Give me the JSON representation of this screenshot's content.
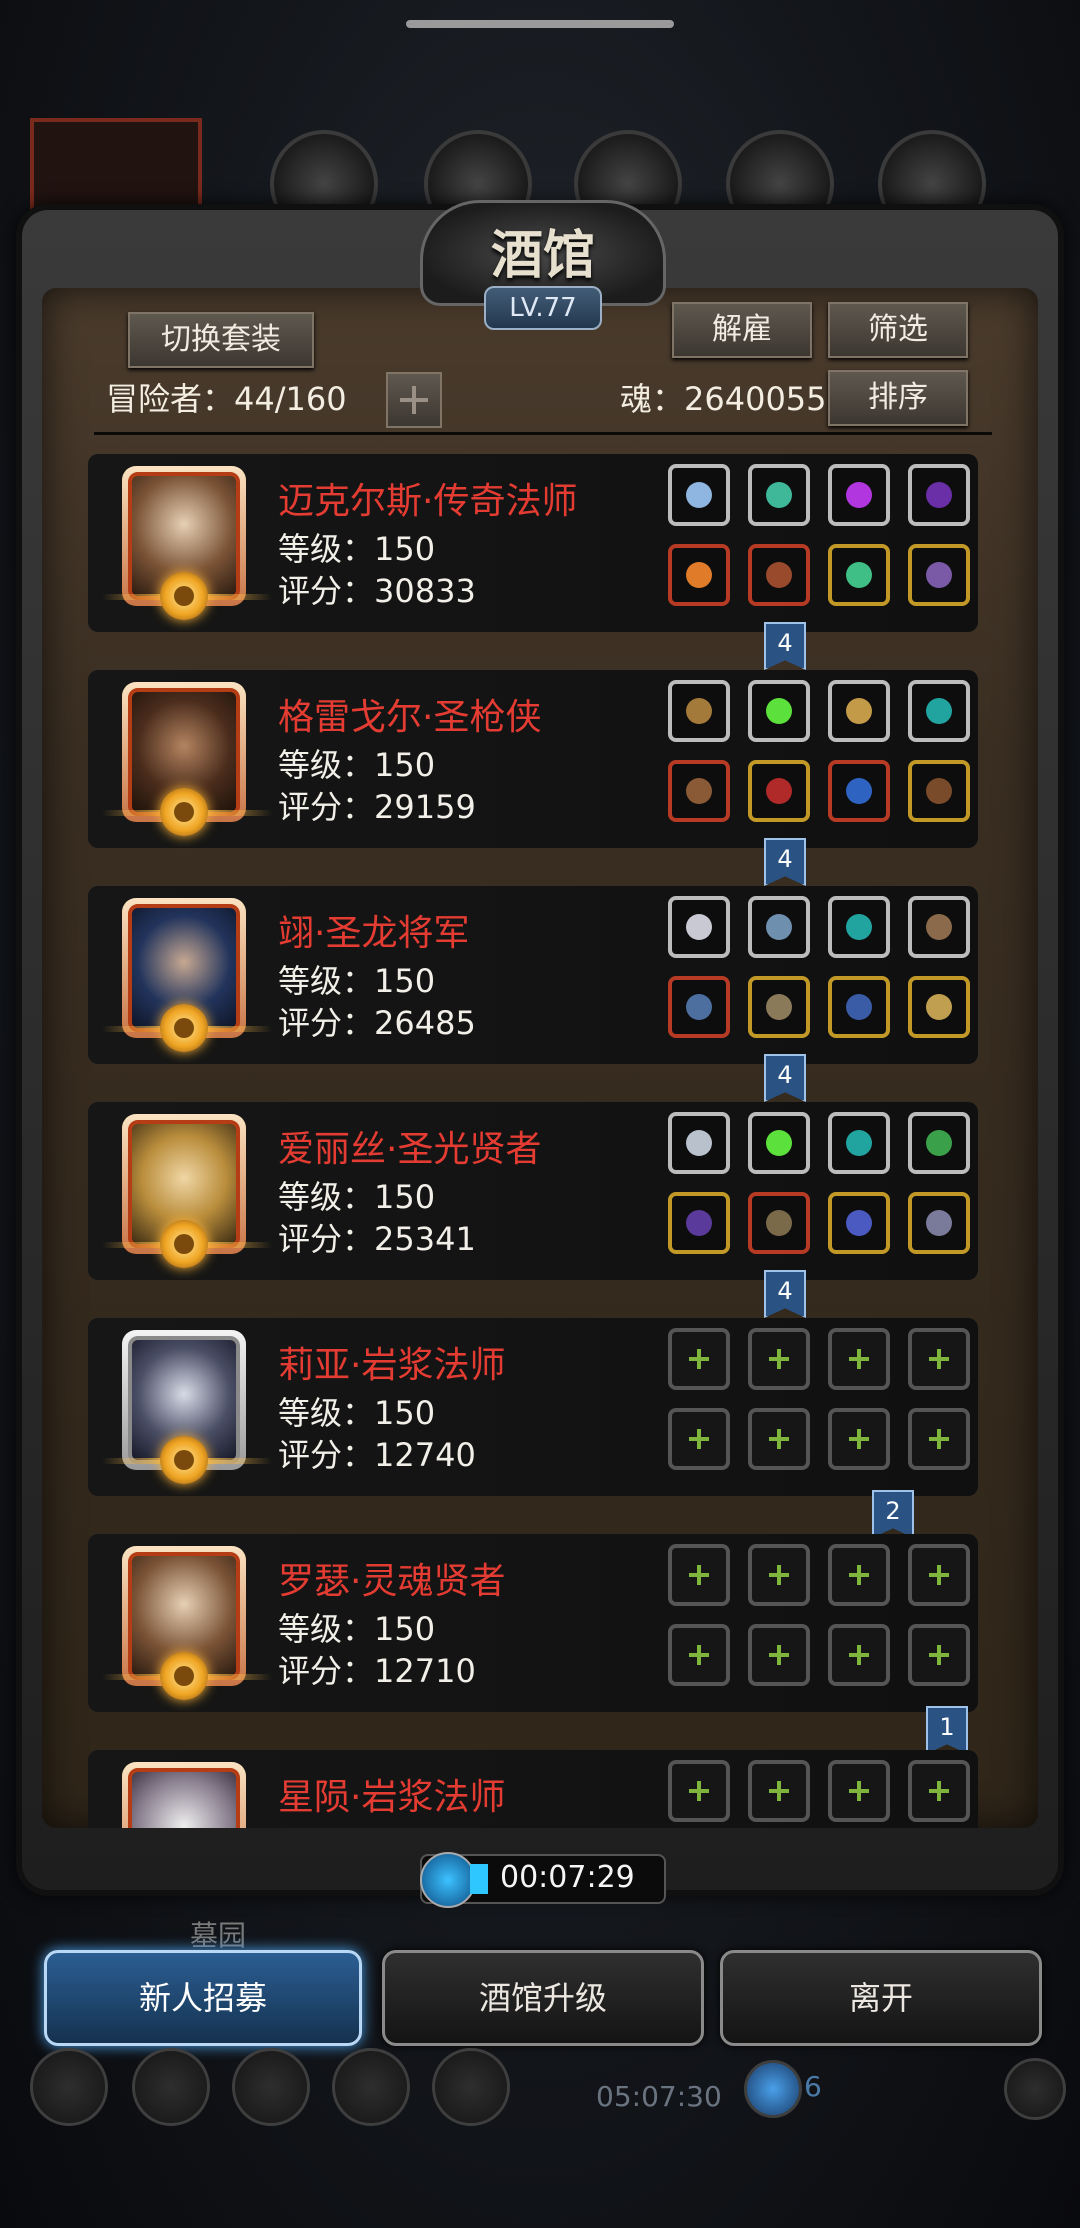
{
  "window": {
    "title": "酒馆",
    "level": "LV.77"
  },
  "toolbar": {
    "switch_outfit": "切换套装",
    "dismiss": "解雇",
    "filter": "筛选",
    "sort": "排序"
  },
  "stats": {
    "adventurers_label": "冒险者：44/160",
    "soul_label": "魂：2640055"
  },
  "heroes": [
    {
      "name": "迈克尔斯·传奇法师",
      "level": "等级：150",
      "score": "评分：30833",
      "badge": "4"
    },
    {
      "name": "格雷戈尔·圣枪侠",
      "level": "等级：150",
      "score": "评分：29159",
      "badge": "4"
    },
    {
      "name": "翊·圣龙将军",
      "level": "等级：150",
      "score": "评分：26485",
      "badge": "4"
    },
    {
      "name": "爱丽丝·圣光贤者",
      "level": "等级：150",
      "score": "评分：25341",
      "badge": "4"
    },
    {
      "name": "莉亚·岩浆法师",
      "level": "等级：150",
      "score": "评分：12740",
      "badge": "2"
    },
    {
      "name": "罗瑟·灵魂贤者",
      "level": "等级：150",
      "score": "评分：12710",
      "badge": "1"
    },
    {
      "name": "星陨·岩浆法师",
      "level": "",
      "score": "",
      "badge": ""
    }
  ],
  "timer": {
    "remaining": "00:07:29"
  },
  "background": {
    "place_label": "墓园",
    "timer2": "05:07:30",
    "count": "6"
  },
  "bottom_buttons": {
    "recruit": "新人招募",
    "upgrade": "酒馆升级",
    "leave": "离开"
  },
  "colors": {
    "hero_name": "#e43c32",
    "accent_blue": "#2b5e93",
    "panel_brown": "#3a2e22"
  }
}
